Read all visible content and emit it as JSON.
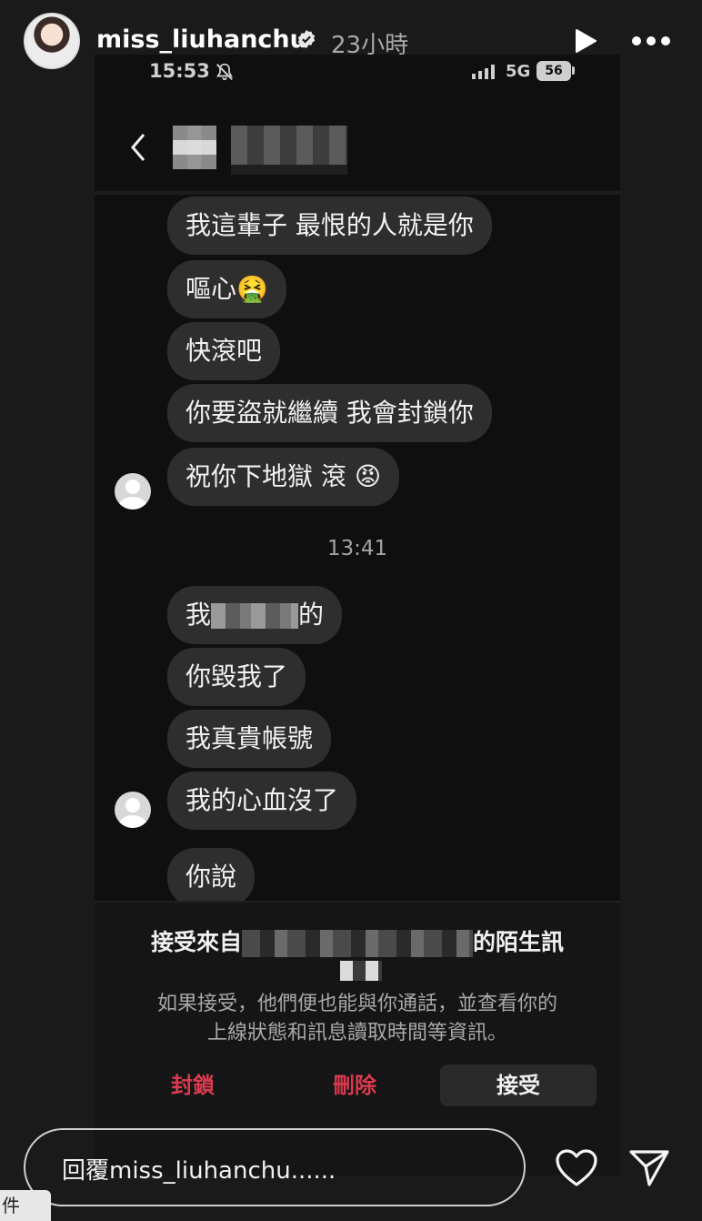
{
  "story": {
    "username": "miss_liuhanchu",
    "posted": "23小時",
    "icons": [
      "verified-badge-icon",
      "play-icon",
      "more-icon"
    ]
  },
  "phone_status": {
    "time": "15:53",
    "network": "5G",
    "battery": "56"
  },
  "chat": {
    "group1": [
      "我這輩子 最恨的人就是你",
      "嘔心",
      "快滾吧",
      "你要盜就繼續 我會封鎖你",
      "祝你下地獄 滾"
    ],
    "emoji_vomit": "🤮",
    "emoji_angry": "😡",
    "timestamp": "13:41",
    "group2": {
      "first_prefix": "我",
      "first_suffix": "的",
      "rest": [
        "你毀我了",
        "我真貴帳號",
        "我的心血沒了",
        "你說"
      ]
    }
  },
  "request": {
    "title_prefix": "接受來自",
    "title_suffix": "的陌生訊",
    "description_line1": "如果接受，他們便也能與你通話，並查看你的",
    "description_line2": "上線狀態和訊息讀取時間等資訊。",
    "block_label": "封鎖",
    "delete_label": "刪除",
    "accept_label": "接受"
  },
  "reply": {
    "placeholder": "回覆miss_liuhanchu......"
  },
  "corner_label": "件"
}
